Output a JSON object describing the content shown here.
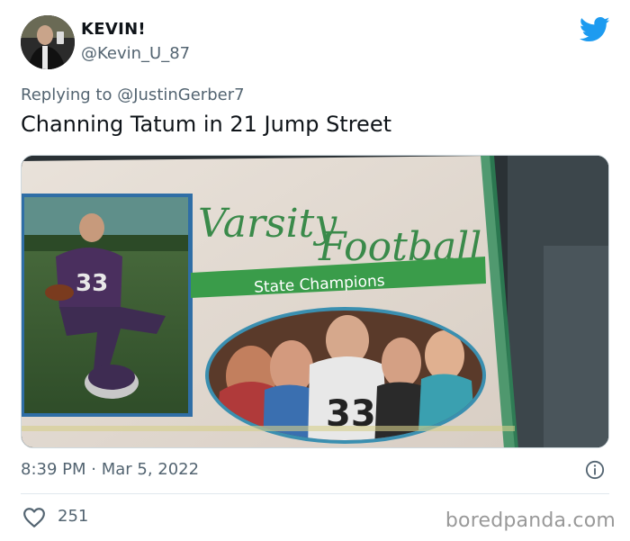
{
  "tweet": {
    "display_name": "KEVIN!",
    "handle": "@Kevin_U_87",
    "reply_prefix": "Replying to",
    "reply_to": "@JustinGerber7",
    "text": "Channing Tatum in 21 Jump Street",
    "timestamp": "8:39 PM · Mar 5, 2022",
    "likes": "251"
  },
  "media": {
    "yearbook_title_1": "Varsity",
    "yearbook_title_2": "Football",
    "yearbook_banner": "State Champions",
    "jersey_number": "33"
  },
  "icons": {
    "brand": "twitter-bird-icon",
    "info": "info-icon",
    "like": "heart-icon"
  },
  "colors": {
    "twitter_blue": "#1d9bf0",
    "secondary_text": "#536471",
    "banner_green": "#3a9c4a"
  },
  "watermark": "boredpanda.com"
}
